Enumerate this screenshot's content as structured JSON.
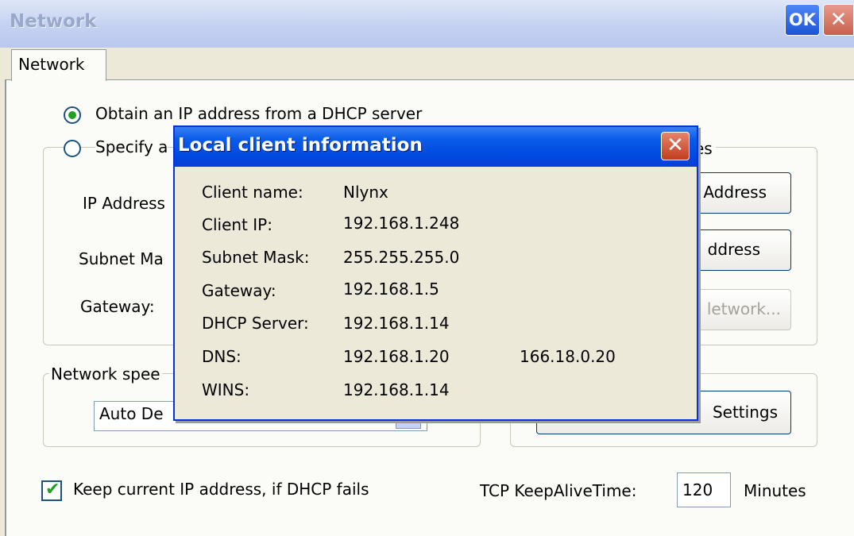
{
  "window": {
    "title": "Network",
    "ok_label": "OK",
    "close_label": "✕"
  },
  "tabs": [
    {
      "label": "Network"
    }
  ],
  "ip_mode": {
    "dhcp_label": "Obtain an IP address from a DHCP server",
    "dhcp_selected": true,
    "specify_label_visible": "Specify a",
    "ip_address_label": "IP Address",
    "subnet_label": "Subnet Ma",
    "gateway_label": "Gateway:",
    "group_title_visible": "es"
  },
  "side_buttons": {
    "btn1": "Address",
    "btn2": "ddress",
    "btn3": "letwork...",
    "btn4": "Settings"
  },
  "network_speed": {
    "group_title_visible": "Network spee",
    "dropdown_value_visible": "Auto De"
  },
  "keep_ip": {
    "label": "Keep current IP address, if DHCP fails",
    "checked": true
  },
  "keepalive": {
    "label": "TCP KeepAliveTime:",
    "value": "120",
    "unit": "Minutes"
  },
  "dialog": {
    "title": "Local client information",
    "close_label": "✕",
    "rows": [
      {
        "label": "Client name:",
        "value": "Nlynx",
        "extra": ""
      },
      {
        "label": "Client IP:",
        "value": "192.168.1.248",
        "extra": ""
      },
      {
        "label": "Subnet Mask:",
        "value": "255.255.255.0",
        "extra": ""
      },
      {
        "label": "Gateway:",
        "value": "192.168.1.5",
        "extra": ""
      },
      {
        "label": "DHCP Server:",
        "value": "192.168.1.14",
        "extra": ""
      },
      {
        "label": "DNS:",
        "value": "192.168.1.20",
        "extra": "166.18.0.20"
      },
      {
        "label": "WINS:",
        "value": "192.168.1.14",
        "extra": ""
      }
    ]
  },
  "colors": {
    "window_bg": "#ECE9D8",
    "dialog_titlebar": "#0a5ce8",
    "radio_dot": "#21a121",
    "checkmark": "#21a121"
  }
}
